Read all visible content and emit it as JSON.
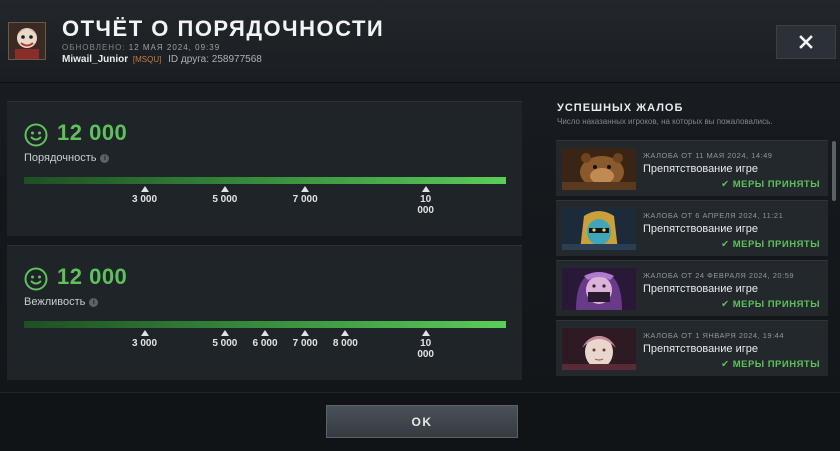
{
  "header": {
    "title": "ОТЧЁТ О ПОРЯДОЧНОСТИ",
    "updated_label": "ОБНОВЛЕНО:",
    "updated_value": "12 МАЯ 2024, 09:39",
    "username": "Miwail_Junior",
    "user_tag": "[MSQU]",
    "friend_id_label": "ID друга:",
    "friend_id": "258977568"
  },
  "conduct": {
    "score": "12 000",
    "label": "Порядочность",
    "info_icon": "i",
    "markers": [
      {
        "label": "3 000",
        "value": 3000
      },
      {
        "label": "5 000",
        "value": 5000
      },
      {
        "label": "7 000",
        "value": 7000
      },
      {
        "label": "10 000",
        "value": 10000
      }
    ]
  },
  "politeness": {
    "score": "12 000",
    "label": "Вежливость",
    "info_icon": "i",
    "markers": [
      {
        "label": "3 000",
        "value": 3000
      },
      {
        "label": "5 000",
        "value": 5000
      },
      {
        "label": "6 000",
        "value": 6000
      },
      {
        "label": "7 000",
        "value": 7000
      },
      {
        "label": "8 000",
        "value": 8000
      },
      {
        "label": "10 000",
        "value": 10000
      }
    ]
  },
  "reports": {
    "title": "УСПЕШНЫХ ЖАЛОБ",
    "subtitle": "Число наказанных игроков, на которых вы пожаловались.",
    "items": [
      {
        "date": "ЖАЛОБА ОТ 11 МАЯ 2024, 14:49",
        "reason": "Препятствование игре",
        "status": "МЕРЫ ПРИНЯТЫ",
        "hero": "bear-hero"
      },
      {
        "date": "ЖАЛОБА ОТ 6 АПРЕЛЯ 2024, 11:21",
        "reason": "Препятствование игре",
        "status": "МЕРЫ ПРИНЯТЫ",
        "hero": "masked-hero"
      },
      {
        "date": "ЖАЛОБА ОТ 24 ФЕВРАЛЯ 2024, 20:59",
        "reason": "Препятствование игре",
        "status": "МЕРЫ ПРИНЯТЫ",
        "hero": "purple-hero"
      },
      {
        "date": "ЖАЛОБА ОТ 1 ЯНВАРЯ 2024, 19:44",
        "reason": "Препятствование игре",
        "status": "МЕРЫ ПРИНЯТЫ",
        "hero": "pale-hero"
      }
    ]
  },
  "footer": {
    "ok_label": "OK"
  },
  "colors": {
    "accent_green": "#5ec15a",
    "background": "#15191d",
    "panel": "#1f2428"
  },
  "icons": {
    "close": "close-icon",
    "smiley": "smiley-icon",
    "check": "check-icon",
    "info": "info-icon"
  }
}
